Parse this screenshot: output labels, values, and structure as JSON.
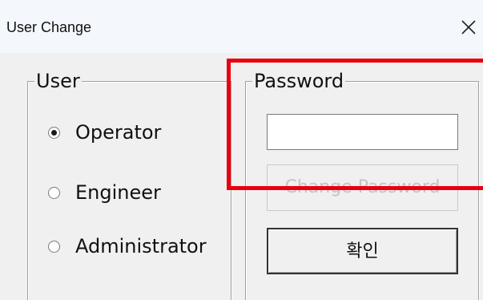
{
  "window": {
    "title": "User Change",
    "close_icon": "close-icon"
  },
  "user_group": {
    "label": "User",
    "options": [
      {
        "label": "Operator",
        "checked": true
      },
      {
        "label": "Engineer",
        "checked": false
      },
      {
        "label": "Administrator",
        "checked": false
      }
    ]
  },
  "password_group": {
    "label": "Password",
    "input_value": "",
    "change_password_label": "Change Password",
    "change_password_enabled": false,
    "ok_label": "확인"
  },
  "colors": {
    "highlight": "#e8000c",
    "title_bar": "#f4f7fc",
    "dialog_bg": "#f0f0f0"
  }
}
